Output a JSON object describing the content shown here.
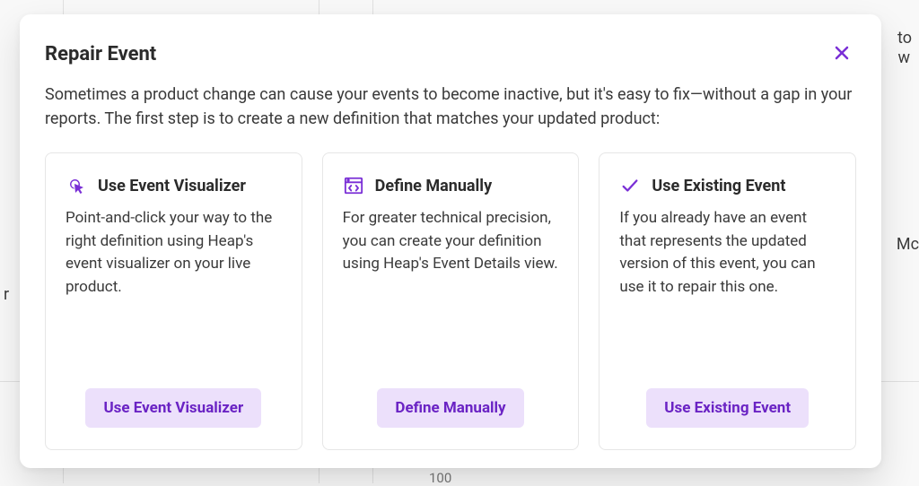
{
  "modal": {
    "title": "Repair Event",
    "description": "Sometimes a product change can cause your events to become inactive, but it's easy to fix—without a gap in your reports. The first step is to create a new definition that matches your updated product:"
  },
  "cards": {
    "visualizer": {
      "title": "Use Event Visualizer",
      "body": "Point-and-click your way to the right definition using Heap's event visualizer on your live product.",
      "button": "Use Event Visualizer"
    },
    "manual": {
      "title": "Define Manually",
      "body": "For greater technical precision, you can create your definition using Heap's Event Details view.",
      "button": "Define Manually"
    },
    "existing": {
      "title": "Use Existing Event",
      "body": "If you already have an event that represents the updated version of this event, you can use it to repair this one.",
      "button": "Use Existing Event"
    }
  },
  "background": {
    "frag_to": "to",
    "frag_w": "w",
    "frag_mc": "Mc",
    "frag_r": "r",
    "frag_100": "100"
  }
}
